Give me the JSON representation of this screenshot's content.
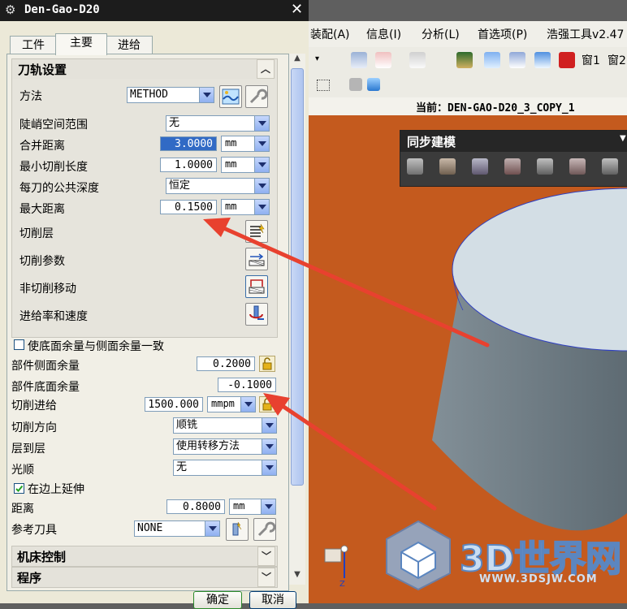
{
  "dialog": {
    "title": "Den-Gao-D20",
    "tabs": [
      "工件",
      "主要",
      "进给"
    ],
    "active_tab": "主要",
    "path_settings": {
      "header": "刀轨设置",
      "method_label": "方法",
      "method_value": "METHOD",
      "steep_label": "陡峭空间范围",
      "steep_value": "无",
      "merge_label": "合并距离",
      "merge_value": "3.0000",
      "merge_unit": "mm",
      "min_cut_label": "最小切削长度",
      "min_cut_value": "1.0000",
      "min_cut_unit": "mm",
      "depth_label": "每刀的公共深度",
      "depth_value": "恒定",
      "max_dist_label": "最大距离",
      "max_dist_value": "0.1500",
      "max_dist_unit": "mm",
      "cut_levels_label": "切削层",
      "cut_params_label": "切削参数",
      "non_cut_label": "非切削移动",
      "feeds_label": "进给率和速度"
    },
    "stock": {
      "same_floor_label": "使底面余量与侧面余量一致",
      "side_stock_label": "部件侧面余量",
      "side_stock_value": "0.2000",
      "floor_stock_label": "部件底面余量",
      "floor_stock_value": "-0.1000",
      "stepover_label": "切削进给",
      "stepover_value": "1500.000",
      "stepover_unit": "mmpm",
      "direction_label": "切削方向",
      "direction_value": "顺铣",
      "level_label": "层到层",
      "level_value": "使用转移方法",
      "smooth_label": "光顺",
      "smooth_value": "无",
      "extend_label": "在边上延伸",
      "distance_label": "距离",
      "distance_value": "0.8000",
      "distance_unit": "mm",
      "ref_tool_label": "参考刀具",
      "ref_tool_value": "NONE"
    },
    "machine_control": "机床控制",
    "program": "程序",
    "ok": "确定",
    "cancel": "取消"
  },
  "menubar": [
    "装配(A)",
    "信息(I)",
    "分析(L)",
    "首选项(P)",
    "浩强工具v2.47"
  ],
  "toolbar": {
    "win1": "窗1",
    "win2": "窗2"
  },
  "status": {
    "current": "当前：DEN-GAO-D20_3_COPY_1"
  },
  "sync_toolbar": {
    "title": "同步建模"
  },
  "watermark": {
    "brand": "3D世界网",
    "url": "WWW.3DSJW.COM"
  },
  "colors": {
    "viewport": "#c45a1e",
    "accent": "#316ac5",
    "arrow": "#e8412f",
    "model_top": "#d2dde4",
    "model_side": "#6e7c85"
  }
}
